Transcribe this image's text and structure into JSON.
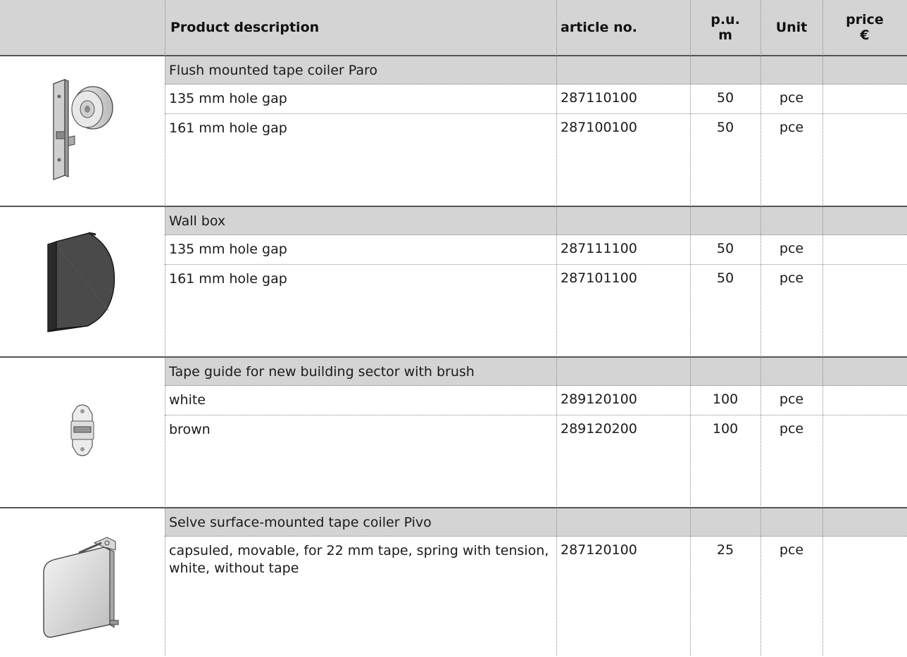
{
  "header": {
    "image": "",
    "description": "Product description",
    "article": "article no.",
    "pu_line1": "p.u.",
    "pu_line2": "m",
    "unit": "Unit",
    "price_line1": "price",
    "price_line2": "€"
  },
  "groups": [
    {
      "title": "Flush mounted tape coiler Paro",
      "icon": "flush-tape-coiler-icon",
      "rows": [
        {
          "desc": "135 mm hole gap",
          "article": "287110100",
          "pu": "50",
          "unit": "pce",
          "price": ""
        },
        {
          "desc": "161 mm hole gap",
          "article": "287100100",
          "pu": "50",
          "unit": "pce",
          "price": ""
        }
      ]
    },
    {
      "title": "Wall box",
      "icon": "wall-box-icon",
      "rows": [
        {
          "desc": "135 mm hole gap",
          "article": "287111100",
          "pu": "50",
          "unit": "pce",
          "price": ""
        },
        {
          "desc": "161 mm hole gap",
          "article": "287101100",
          "pu": "50",
          "unit": "pce",
          "price": ""
        }
      ]
    },
    {
      "title": "Tape guide for new building sector with brush",
      "icon": "tape-guide-icon",
      "rows": [
        {
          "desc": "white",
          "article": "289120100",
          "pu": "100",
          "unit": "pce",
          "price": ""
        },
        {
          "desc": "brown",
          "article": "289120200",
          "pu": "100",
          "unit": "pce",
          "price": ""
        }
      ]
    },
    {
      "title": "Selve surface-mounted tape coiler Pivo",
      "icon": "surface-tape-coiler-icon",
      "rows": [
        {
          "desc": "capsuled, movable, for 22 mm tape, spring with tension, white, without tape",
          "article": "287120100",
          "pu": "25",
          "unit": "pce",
          "price": ""
        }
      ]
    }
  ],
  "colors": {
    "header_bg": "#d4d4d4",
    "group_title_bg": "#d4d4d4",
    "rule": "#555555"
  }
}
